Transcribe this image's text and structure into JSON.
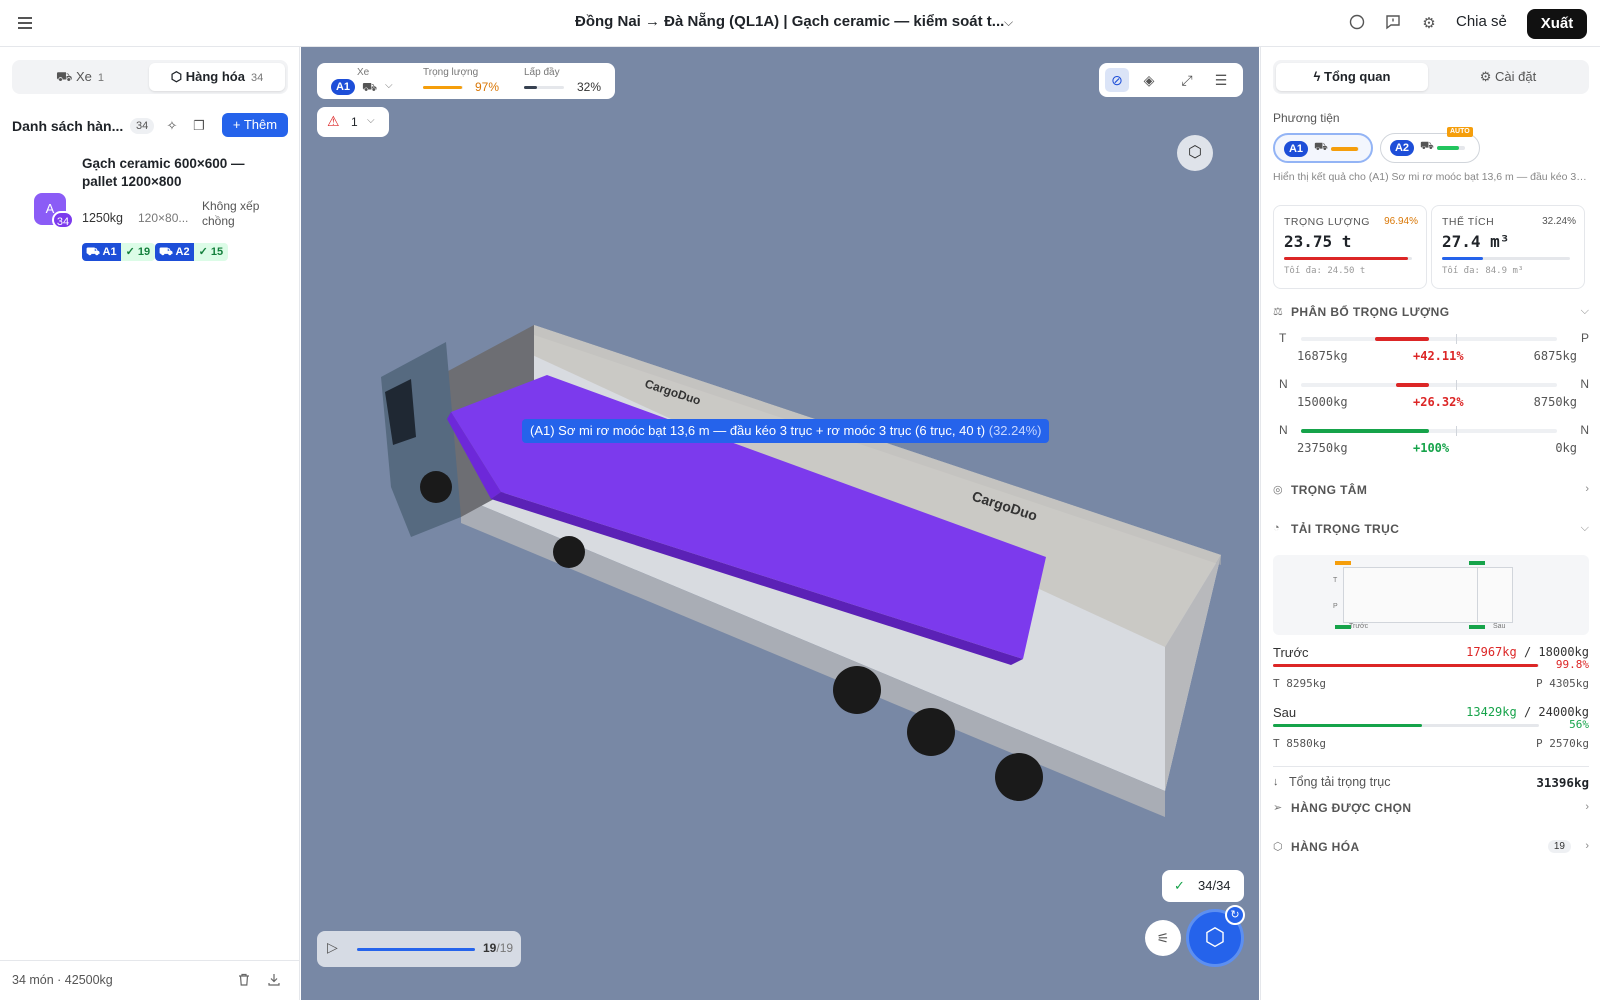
{
  "topbar": {
    "title": "Đồng Nai → Đà Nẵng (QL1A) | Gạch ceramic — kiểm soát t...",
    "share_label": "Chia sẻ",
    "export_label": "Xuất"
  },
  "left": {
    "tabs": [
      {
        "label": "Xe",
        "count": "1"
      },
      {
        "label": "Hàng hóa",
        "count": "34"
      }
    ],
    "list_title": "Danh sách hàn...",
    "list_count": "34",
    "add_label": "+ Thêm",
    "item": {
      "avatar": "A",
      "badge": "34",
      "name": "Gạch ceramic 600×600 — pallet 1200×800",
      "weight": "1250kg",
      "dims": "120×80...",
      "stack": "Không xếp chồng",
      "tags": [
        {
          "vehicle": "A1",
          "count": "✓ 19"
        },
        {
          "vehicle": "A2",
          "count": "✓ 15"
        }
      ]
    },
    "footer": "34 món · 42500kg"
  },
  "viewport": {
    "stats": {
      "vehicle_label": "Xe",
      "vehicle_id": "A1",
      "weight_label": "Trọng lượng",
      "weight_value": "97%",
      "weight_fraction": 0.97,
      "fill_label": "Lấp đầy",
      "fill_value": "32%",
      "fill_fraction": 0.32
    },
    "warnings": "1",
    "overlay_label": "(A1) Sơ mi rơ moóc bạt 13,6 m — đầu kéo 3 trục + rơ moóc 3 trục (6 trục, 40 t)",
    "overlay_pct": "(32.24%)",
    "brand": "CargoDuo",
    "placed": "34/34",
    "player_step": "19",
    "player_total": "/19",
    "colors": {
      "accent": "#2563eb",
      "cargo": "#7c3aed",
      "background": "#7888a5"
    }
  },
  "right": {
    "tabs": [
      {
        "label": "Tổng quan"
      },
      {
        "label": "Cài đặt"
      }
    ],
    "vehicles_label": "Phương tiện",
    "vehicles": [
      {
        "id": "A1",
        "fill": 0.97,
        "color": "#f59e0b"
      },
      {
        "id": "A2",
        "fill": 0.8,
        "color": "#22c55e",
        "tag": "AUTO"
      }
    ],
    "vehicle_desc": "Hiển thị kết quả cho (A1) Sơ mi rơ moóc bạt 13,6 m — đầu kéo 3 t...",
    "metrics": [
      {
        "label": "TRỌNG LƯỢNG",
        "pct": "96.94%",
        "value": "23.75 t",
        "max": "Tối đa: 24.50 t",
        "fraction": 0.9694,
        "color": "#dc2626",
        "pct_color": "#d97706"
      },
      {
        "label": "THỂ TÍCH",
        "pct": "32.24%",
        "value": "27.4 m³",
        "max": "Tối đa: 84.9 m³",
        "fraction": 0.3224,
        "color": "#2563eb",
        "pct_color": "#555555"
      }
    ],
    "sections": {
      "weight_dist": "PHÂN BỔ TRỌNG LƯỢNG",
      "center": "TRỌNG TÂM",
      "axle_load": "TẢI TRỌNG TRỤC",
      "selected": "HÀNG ĐƯỢC CHỌN",
      "cargo": "HÀNG HÓA",
      "cargo_count": "19"
    },
    "distribution": [
      {
        "left_label": "T",
        "right_label": "P",
        "left_value": "16875kg",
        "mid_value": "+42.11%",
        "right_value": "6875kg",
        "mid_color": "#dc2626",
        "bar_color": "#dc2626",
        "from": 0.29,
        "to": 0.5
      },
      {
        "left_label": "N",
        "right_label": "N",
        "left_value": "15000kg",
        "mid_value": "+26.32%",
        "right_value": "8750kg",
        "mid_color": "#dc2626",
        "bar_color": "#dc2626",
        "from": 0.37,
        "to": 0.5
      },
      {
        "left_label": "N",
        "right_label": "N",
        "left_value": "23750kg",
        "mid_value": "+100%",
        "right_value": "0kg",
        "mid_color": "#16a34a",
        "bar_color": "#16a34a",
        "from": 0.0,
        "to": 0.5
      }
    ],
    "axle_chart": {
      "front_label": "Trước",
      "rear_label": "Sau",
      "t_label": "T",
      "p_label": "P"
    },
    "axles": [
      {
        "name": "Trước",
        "load": "17967kg",
        "limit": "/ 18000kg",
        "pct": "99.8%",
        "fraction": 0.998,
        "color": "#dc2626",
        "left": "T 8295kg",
        "right": "P 4305kg"
      },
      {
        "name": "Sau",
        "load": "13429kg",
        "limit": "/ 24000kg",
        "pct": "56%",
        "fraction": 0.56,
        "color": "#16a34a",
        "left": "T 8580kg",
        "right": "P 2570kg"
      }
    ],
    "axle_total_label": "Tổng tải trọng trục",
    "axle_total_value": "31396kg"
  }
}
